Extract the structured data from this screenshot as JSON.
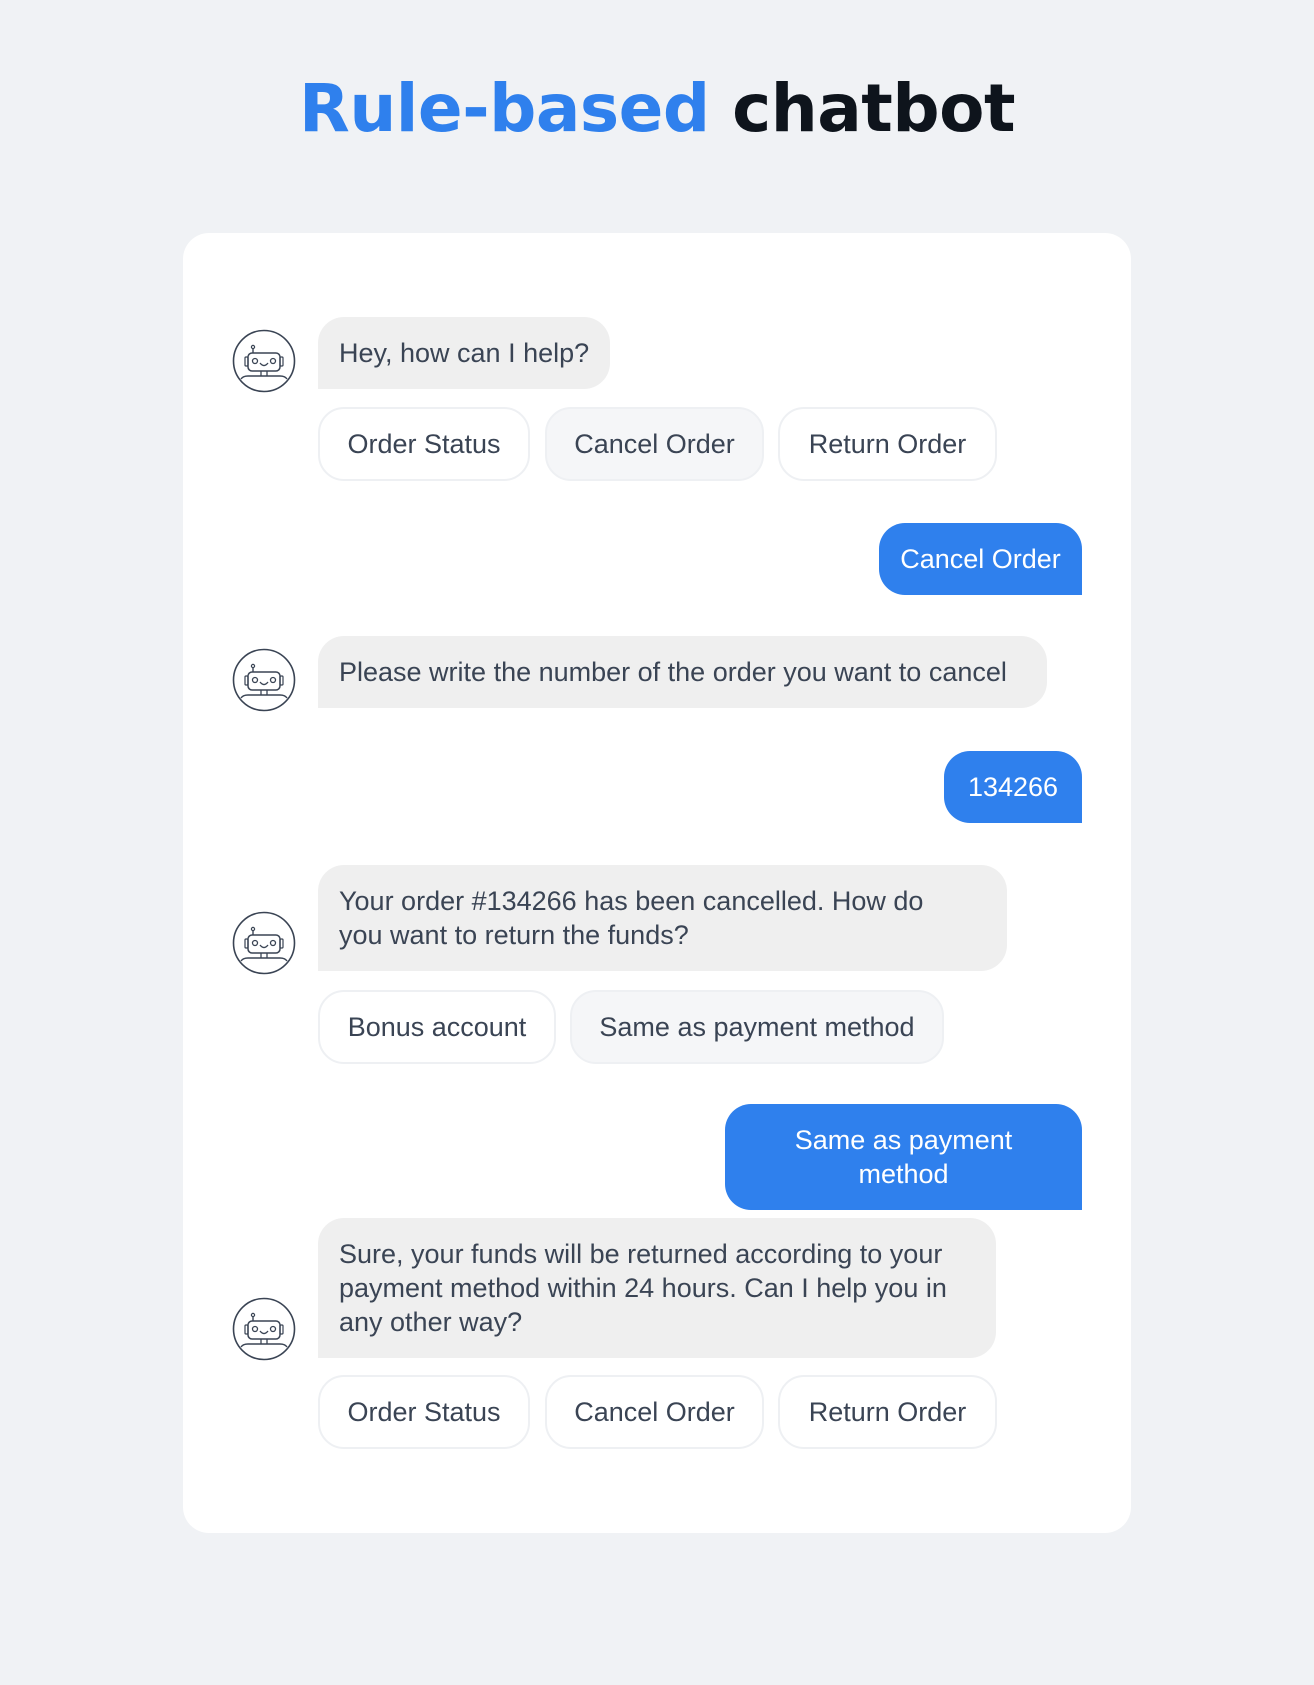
{
  "title": {
    "accent": "Rule-based",
    "rest": "chatbot"
  },
  "colors": {
    "accent": "#2f80ed",
    "title_dark": "#0e141c",
    "bot_bubble": "#efefef",
    "text": "#3a4454",
    "background": "#f0f2f5",
    "card": "#ffffff"
  },
  "conversation": {
    "messages": [
      {
        "sender": "bot",
        "avatar_icon": "robot-icon",
        "text": "Hey, how can I help?",
        "options": [
          {
            "label": "Order Status",
            "selected": false
          },
          {
            "label": "Cancel Order",
            "selected": true
          },
          {
            "label": "Return Order",
            "selected": false
          }
        ]
      },
      {
        "sender": "user",
        "text": "Cancel Order"
      },
      {
        "sender": "bot",
        "avatar_icon": "robot-icon",
        "text": "Please write the number of the order you want to cancel"
      },
      {
        "sender": "user",
        "text": "134266"
      },
      {
        "sender": "bot",
        "avatar_icon": "robot-icon",
        "text_lines": [
          "Your order #134266 has been cancelled. How do",
          "you want to return the funds?"
        ],
        "options": [
          {
            "label": "Bonus account",
            "selected": false
          },
          {
            "label": "Same as payment method",
            "selected": true
          }
        ]
      },
      {
        "sender": "user",
        "text": "Same as payment method"
      },
      {
        "sender": "bot",
        "avatar_icon": "robot-icon",
        "text_lines": [
          "Sure, your funds will be returned according to your",
          "payment method within 24 hours. Can I help you in",
          "any other way?"
        ],
        "options": [
          {
            "label": "Order Status",
            "selected": false
          },
          {
            "label": "Cancel Order",
            "selected": false
          },
          {
            "label": "Return Order",
            "selected": false
          }
        ]
      }
    ]
  }
}
